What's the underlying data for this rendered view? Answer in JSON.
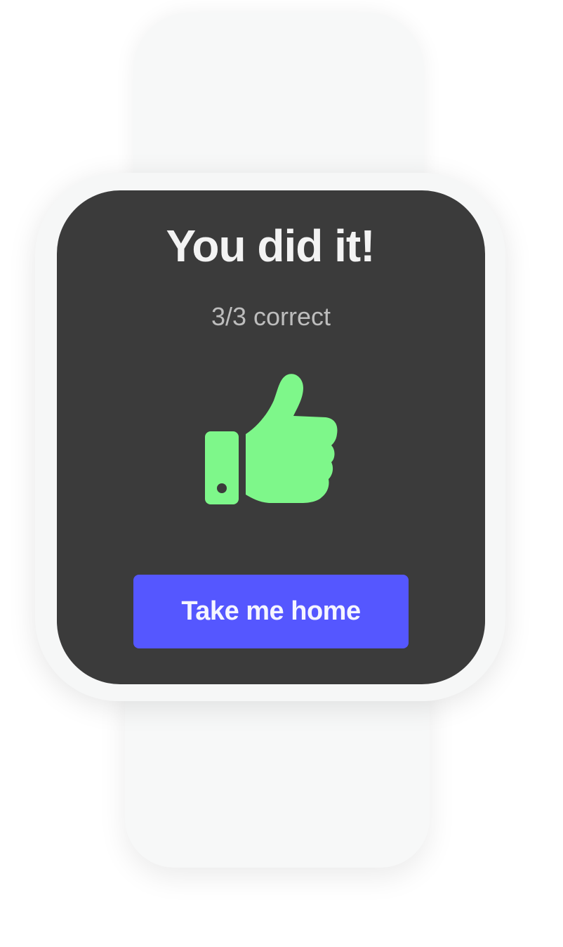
{
  "screen": {
    "title": "You did it!",
    "score": "3/3 correct",
    "result_icon": "thumbs-up-icon",
    "result_icon_color": "#7ef78a",
    "button_label": "Take me home",
    "button_color": "#5557ff",
    "background_color": "#3b3b3b"
  }
}
